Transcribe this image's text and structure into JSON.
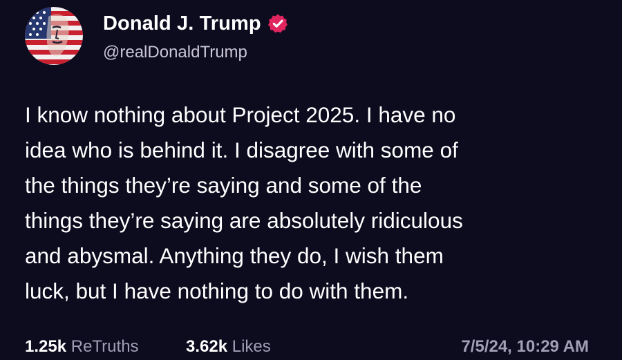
{
  "profile": {
    "display_name": "Donald J. Trump",
    "handle": "@realDonaldTrump",
    "verified": true,
    "verified_color": "#e0245e",
    "avatar_icon": "flag-portrait-avatar"
  },
  "post": {
    "text": "I know nothing about Project 2025. I have no\nidea who is behind it. I disagree with some of\nthe things they’re saying and some of the\nthings they’re saying are absolutely ridiculous\nand abysmal. Anything they do, I wish them\nluck, but I have nothing to do with them."
  },
  "stats": {
    "retruths_count": "1.25k",
    "retruths_label": "ReTruths",
    "likes_count": "3.62k",
    "likes_label": "Likes",
    "timestamp": "7/5/24, 10:29 AM"
  },
  "colors": {
    "background": "#0d0b1e",
    "text_primary": "#ffffff",
    "text_secondary": "#a19fb4"
  }
}
